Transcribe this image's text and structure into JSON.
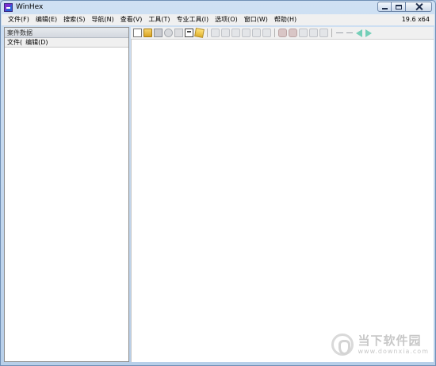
{
  "window": {
    "title": "WinHex",
    "version": "19.6 x64"
  },
  "menubar": {
    "items": [
      "文件(F)",
      "编辑(E)",
      "搜索(S)",
      "导航(N)",
      "查看(V)",
      "工具(T)",
      "专业工具(I)",
      "选项(O)",
      "窗口(W)",
      "帮助(H)"
    ]
  },
  "case_panel": {
    "header": "案件数据",
    "menu": [
      "文件(",
      "编辑(D)"
    ]
  },
  "toolbar": {
    "icons": [
      "new-file-icon",
      "open-file-icon",
      "save-icon",
      "print-icon",
      "refresh-icon",
      "properties-icon",
      "wizard-icon",
      "undo-icon",
      "redo-icon",
      "cut-icon",
      "copy-icon",
      "paste-icon",
      "write-icon",
      "find-icon",
      "find-hex-icon",
      "replace-icon",
      "replace-hex-icon",
      "find-next-icon",
      "goto-offset-icon",
      "goto-sector-icon",
      "back-icon",
      "forward-icon"
    ]
  },
  "watermark": {
    "title": "当下软件园",
    "url": "www.downxia.com"
  }
}
